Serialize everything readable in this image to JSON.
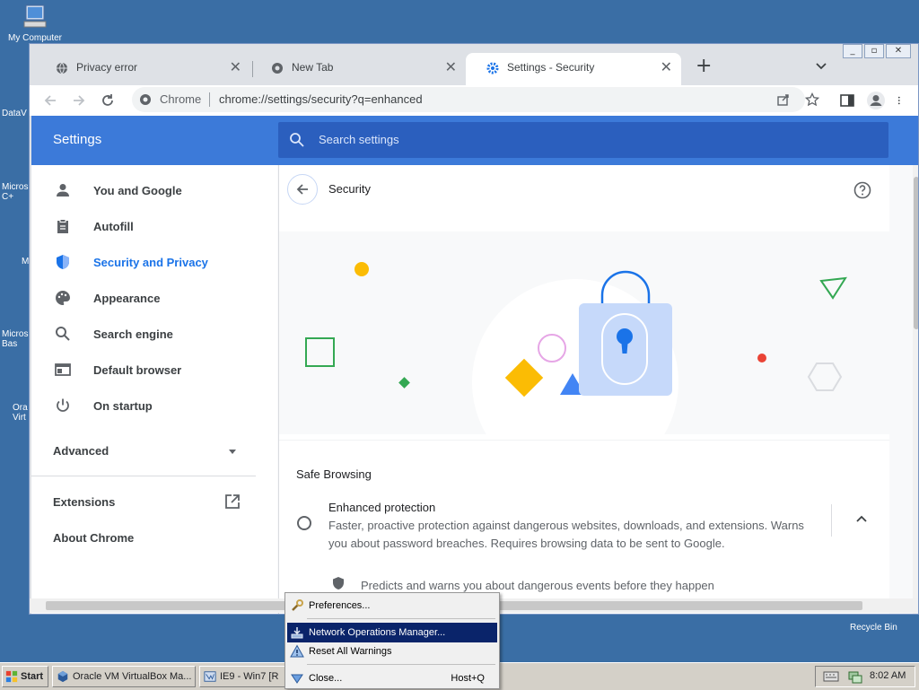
{
  "desktop": {
    "icons": [
      {
        "label": "My Computer"
      },
      {
        "label": "DataV"
      },
      {
        "label": "Micros C+"
      },
      {
        "label": "M"
      },
      {
        "label": "Micros Bas"
      },
      {
        "label": "Ora Virt"
      }
    ],
    "recycle_bin": "Recycle Bin"
  },
  "browser": {
    "tabs": [
      {
        "title": "Privacy error",
        "icon": "globe-icon",
        "active": false
      },
      {
        "title": "New Tab",
        "icon": "chrome-icon",
        "active": false
      },
      {
        "title": "Settings - Security",
        "icon": "gear-icon",
        "active": true
      }
    ],
    "omnibox": {
      "site_label": "Chrome",
      "url": "chrome://settings/security?q=enhanced"
    }
  },
  "settings": {
    "header_title": "Settings",
    "search_placeholder": "Search settings",
    "nav": [
      {
        "label": "You and Google",
        "icon": "person-icon"
      },
      {
        "label": "Autofill",
        "icon": "clipboard-icon"
      },
      {
        "label": "Security and Privacy",
        "icon": "shield-icon",
        "active": true
      },
      {
        "label": "Appearance",
        "icon": "palette-icon"
      },
      {
        "label": "Search engine",
        "icon": "search-icon"
      },
      {
        "label": "Default browser",
        "icon": "browser-icon"
      },
      {
        "label": "On startup",
        "icon": "power-icon"
      }
    ],
    "advanced": "Advanced",
    "extensions": "Extensions",
    "about": "About Chrome",
    "page_title": "Security",
    "section_title": "Safe Browsing",
    "option": {
      "title": "Enhanced protection",
      "desc_line1": "Faster, proactive protection against dangerous websites, downloads, and extensions. Warns",
      "desc_line2": "you about password breaches. Requires browsing data to be sent to Google.",
      "sub": "Predicts and warns you about dangerous events before they happen"
    },
    "colors": {
      "header": "#3c7ad9",
      "accent": "#1a73e8"
    }
  },
  "taskbar": {
    "start": "Start",
    "buttons": [
      {
        "label": "Oracle VM VirtualBox Ma..."
      },
      {
        "label": "IE9 - Win7 [R"
      }
    ],
    "clock": "8:02 AM"
  },
  "context_menu": {
    "items": [
      {
        "label": "Preferences...",
        "shortcut": "",
        "icon": "wrench-icon"
      },
      {
        "label": "Network Operations Manager...",
        "shortcut": "",
        "icon": "download-icon",
        "highlighted": true
      },
      {
        "label": "Reset All Warnings",
        "shortcut": "",
        "icon": "warning-icon"
      },
      {
        "label": "Close...",
        "shortcut": "Host+Q",
        "icon": "close-arrow-icon"
      }
    ]
  }
}
